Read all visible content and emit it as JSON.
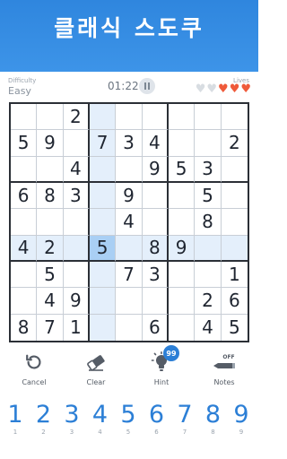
{
  "header": {
    "title": "클래식 스도쿠"
  },
  "status": {
    "difficulty_label": "Difficulty",
    "difficulty_value": "Easy",
    "timer": "01:22",
    "lives_label": "Lives",
    "lives_total": 5,
    "lives_remaining": 3
  },
  "board": {
    "selected_cell": {
      "row": 5,
      "col": 3
    },
    "cells": [
      [
        "",
        "",
        "2",
        "",
        "",
        "",
        "",
        "",
        ""
      ],
      [
        "5",
        "9",
        "",
        "7",
        "3",
        "4",
        "",
        "",
        "2"
      ],
      [
        "",
        "",
        "4",
        "",
        "",
        "9",
        "5",
        "3",
        ""
      ],
      [
        "6",
        "8",
        "3",
        "",
        "9",
        "",
        "",
        "5",
        ""
      ],
      [
        "",
        "",
        "",
        "",
        "4",
        "",
        "",
        "8",
        ""
      ],
      [
        "4",
        "2",
        "",
        "5",
        "",
        "8",
        "9",
        "",
        ""
      ],
      [
        "",
        "5",
        "",
        "",
        "7",
        "3",
        "",
        "",
        "1"
      ],
      [
        "",
        "4",
        "9",
        "",
        "",
        "",
        "",
        "2",
        "6"
      ],
      [
        "8",
        "7",
        "1",
        "",
        "",
        "6",
        "",
        "4",
        "5"
      ]
    ]
  },
  "toolbar": {
    "cancel": "Cancel",
    "clear": "Clear",
    "hint": "Hint",
    "hint_count": "99",
    "notes": "Notes",
    "notes_state": "OFF"
  },
  "numpad": [
    {
      "digit": "1",
      "count": "1"
    },
    {
      "digit": "2",
      "count": "2"
    },
    {
      "digit": "3",
      "count": "3"
    },
    {
      "digit": "4",
      "count": "4"
    },
    {
      "digit": "5",
      "count": "5"
    },
    {
      "digit": "6",
      "count": "6"
    },
    {
      "digit": "7",
      "count": "7"
    },
    {
      "digit": "8",
      "count": "8"
    },
    {
      "digit": "9",
      "count": "9"
    }
  ],
  "colors": {
    "accent": "#2c7fd6",
    "banner": "#3a8fe4",
    "heart": "#ef5a3a",
    "highlight": "#e4effb",
    "selected": "#a9cff4"
  }
}
